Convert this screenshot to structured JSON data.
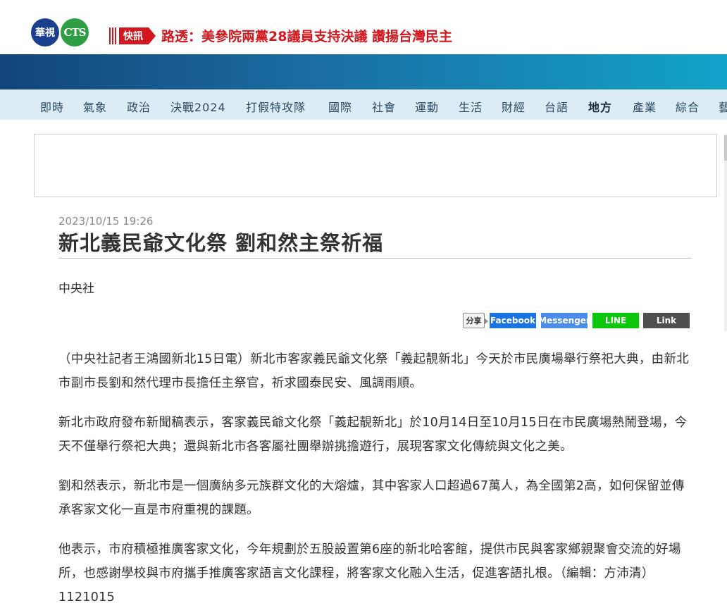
{
  "header": {
    "logo_left": "華視",
    "logo_right": "CTS",
    "flash_tag": "快訊",
    "flash_text": "路透：美參院兩黨28議員支持決議 讚揚台灣民主"
  },
  "nav": {
    "items": [
      {
        "label": "即時"
      },
      {
        "label": "氣象"
      },
      {
        "label": "政治"
      },
      {
        "label": "決戰2024"
      },
      {
        "label": "打假特攻隊"
      },
      {
        "label": "國際"
      },
      {
        "label": "社會"
      },
      {
        "label": "運動"
      },
      {
        "label": "生活"
      },
      {
        "label": "財經"
      },
      {
        "label": "台語"
      },
      {
        "label": "地方",
        "active": true
      },
      {
        "label": "產業"
      },
      {
        "label": "綜合"
      },
      {
        "label": "藝"
      }
    ]
  },
  "article": {
    "date": "2023/10/15 19:26",
    "title": "新北義民爺文化祭 劉和然主祭祈福",
    "source": "中央社",
    "share": {
      "label": "分享",
      "facebook": "Facebook",
      "messenger": "Messenger",
      "line": "LINE",
      "link": "Link"
    },
    "paragraphs": [
      "（中央社記者王鴻國新北15日電）新北市客家義民爺文化祭「義起靚新北」今天於市民廣場舉行祭祀大典，由新北市副市長劉和然代理市長擔任主祭官，祈求國泰民安、風調雨順。",
      "新北市政府發布新聞稿表示，客家義民爺文化祭「義起靚新北」於10月14日至10月15日在市民廣場熱鬧登場，今天不僅舉行祭祀大典；還與新北市各客屬社團舉辦挑擔遊行，展現客家文化傳統與文化之美。",
      "劉和然表示，新北市是一個廣納多元族群文化的大熔爐，其中客家人口超過67萬人，為全國第2高，如何保留並傳承客家文化一直是市府重視的課題。",
      "他表示，市府積極推廣客家文化，今年規劃於五股設置第6座的新北哈客館，提供市民與客家鄉親聚會交流的好場所，也感謝學校與市府攜手推廣客家語言文化課程，將客家文化融入生活，促進客語扎根。（編輯：方沛清）1121015"
    ]
  }
}
